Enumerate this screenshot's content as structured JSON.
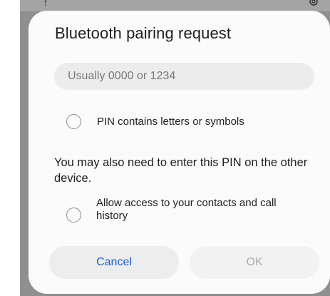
{
  "dialog": {
    "title": "Bluetooth pairing request",
    "pin_input": {
      "placeholder": "Usually 0000 or 1234",
      "value": ""
    },
    "pin_letters_checkbox": {
      "label": "PIN contains letters or symbols",
      "checked": false
    },
    "info_text": "You may also need to enter this PIN on the other device.",
    "contacts_checkbox": {
      "label": "Allow access to your contacts and call history",
      "checked": false
    },
    "buttons": {
      "cancel": "Cancel",
      "ok": "OK"
    }
  },
  "icons": {
    "background_left": "share-icon",
    "background_right": "settings-icon"
  },
  "colors": {
    "cancel_text": "#1b5cd6",
    "ok_text_disabled": "#a9a9a9",
    "dialog_background": "#fbfbfb",
    "scrim": "#8f8f8f"
  }
}
